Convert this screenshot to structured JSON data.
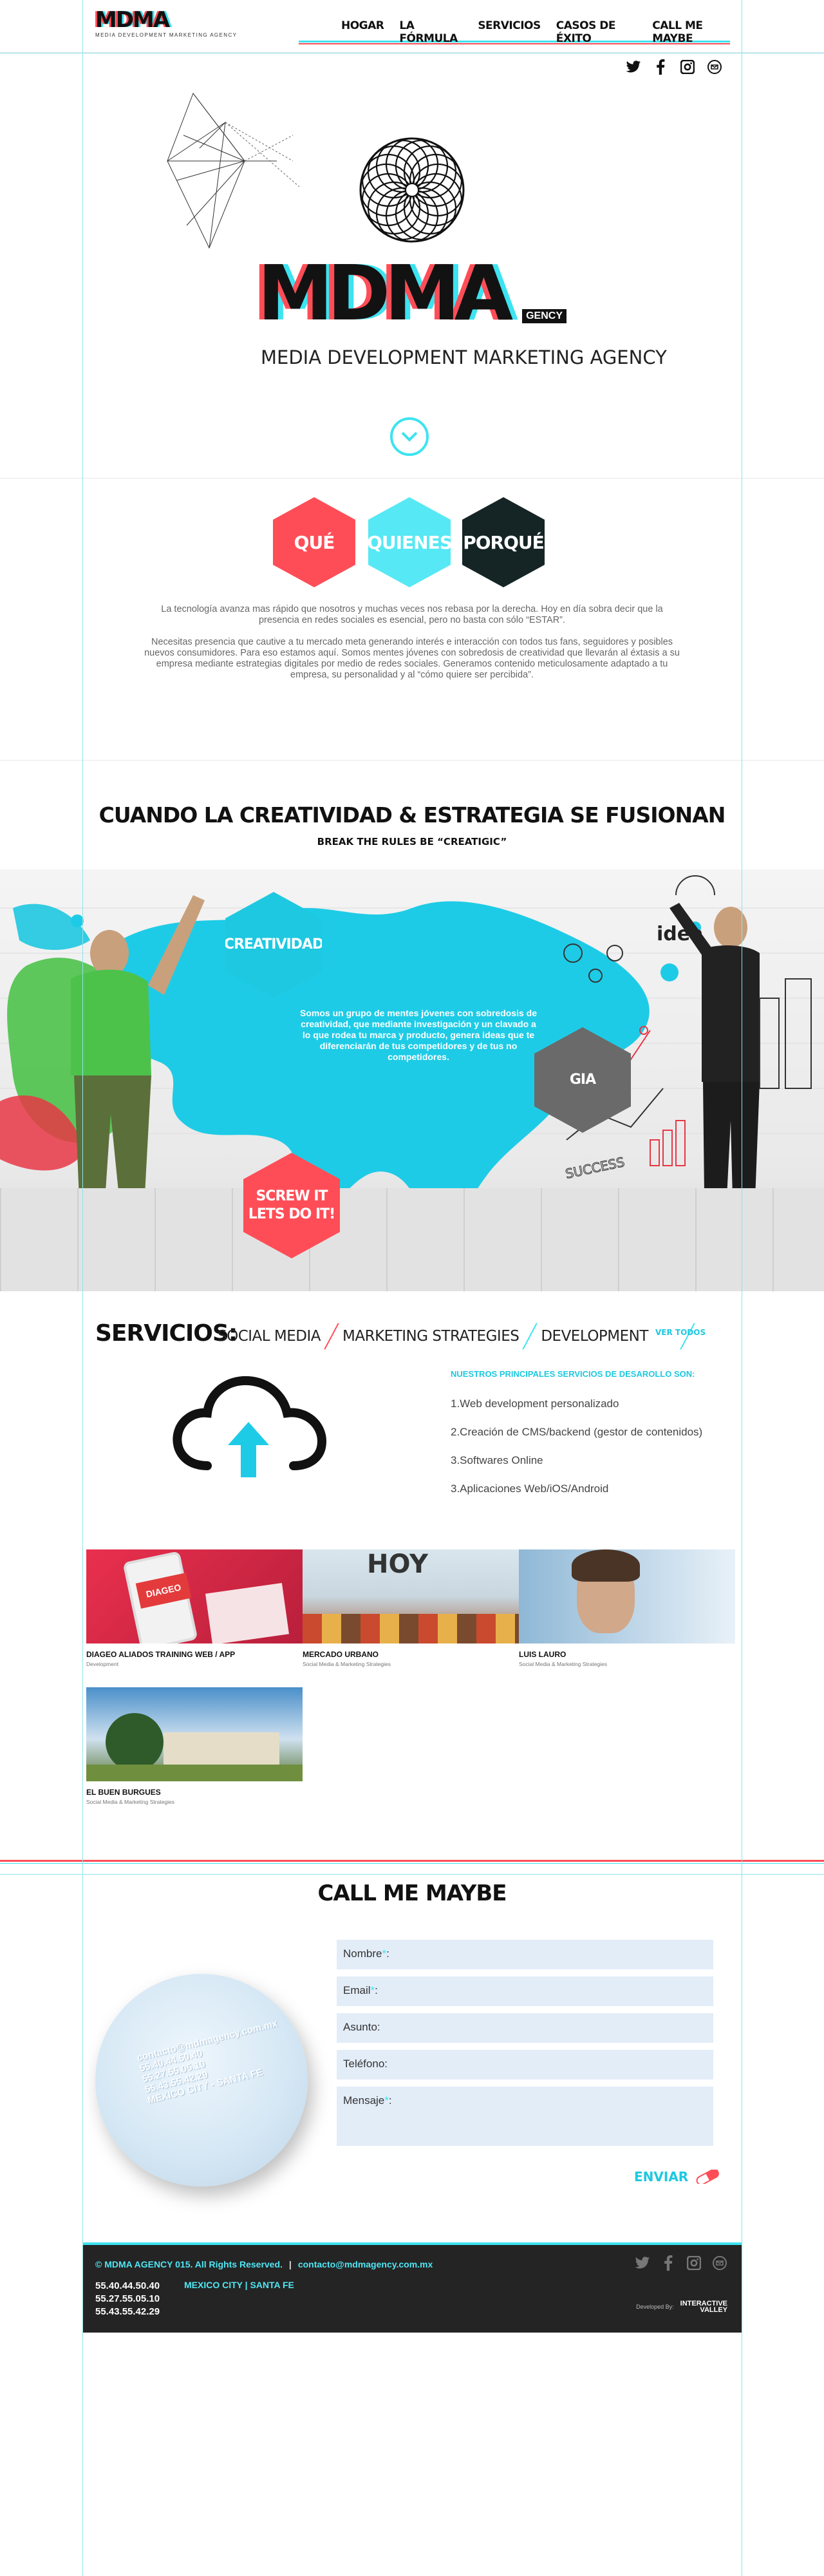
{
  "header": {
    "logo_word": "MDMA",
    "logo_sub": "MEDIA  DEVELOPMENT  MARKETING  AGENCY",
    "nav": [
      "HOGAR",
      "LA FÓRMULA",
      "SERVICIOS",
      "CASOS DE ÉXITO",
      "CALL ME MAYBE"
    ]
  },
  "social": [
    "twitter-icon",
    "facebook-icon",
    "instagram-icon",
    "email-icon"
  ],
  "hero": {
    "title": "MDMA",
    "gency": "GENCY",
    "tagline": "MEDIA  DEVELOPMENT  MARKETING  AGENCY"
  },
  "about": {
    "hexes": [
      {
        "label": "QUÉ",
        "color": "#ff4d57"
      },
      {
        "label": "QUIENES",
        "color": "#56e8f4"
      },
      {
        "label": "PORQUÉ",
        "color": "#152424"
      }
    ],
    "p1": "La tecnología avanza mas rápido que nosotros y muchas veces nos rebasa por la derecha. Hoy en día sobra decir que la presencia en redes sociales es esencial, pero no basta con sólo “ESTAR”.",
    "p2": "Necesitas presencia que cautive a tu mercado meta generando  interés e interacción con todos tus fans, seguidores y posibles nuevos consumidores. Para eso estamos aquí. Somos mentes jóvenes con sobredosis de creatividad que llevarán al éxtasis a su empresa mediante estrategias digitales por medio de redes sociales. Generamos contenido meticulosamente adaptado a tu empresa, su personalidad y al “cómo quiere ser percibida”."
  },
  "headline": {
    "title": "CUANDO LA CREATIVIDAD & ESTRATEGIA SE FUSIONAN",
    "sub": "BREAK THE RULES BE “CREATIGIC”"
  },
  "banner": {
    "hex_creatividad": "CREATIVIDAD",
    "hex_estrategia": "GIA",
    "hex_screw": "SCREW IT\nLETS DO IT!",
    "copy": "Somos  un grupo de mentes jóvenes con sobredosis de creatividad, que mediante investigación y un clavado a lo que rodea tu marca y producto, genera ideas que te diferenciarán de tus competidores y de tus no competidores.",
    "idea": "idea",
    "success": "SUCCESS"
  },
  "services": {
    "title": "SERVICIOS:",
    "tabs": [
      "SOCIAL MEDIA",
      "MARKETING STRATEGIES",
      "DEVELOPMENT"
    ],
    "ver_todos": "VER TODOS",
    "list_title": "NUESTROS PRINCIPALES SERVICIOS DE DESAROLLO SON:",
    "list": [
      "1.Web development personalizado",
      "2.Creación de CMS/backend  (gestor de contenidos)",
      "3.Softwares Online",
      "3.Aplicaciones Web/iOS/Android"
    ]
  },
  "portfolio": [
    {
      "title": "DIAGEO ALIADOS TRAINING WEB / APP",
      "sub": "Development",
      "img_text": "DIAGEO"
    },
    {
      "title": "MERCADO URBANO",
      "sub": "Social Media & Marketing Strategies",
      "img_text": "HOY"
    },
    {
      "title": "LUIS LAURO",
      "sub": "Social Media & Marketing Strategies"
    },
    {
      "title": "EL BUEN BURGUES",
      "sub": "Social Media & Marketing Strategies"
    }
  ],
  "contact": {
    "title": "CALL ME MAYBE",
    "disc_text": "contacto@mdmagency.com.mx\n55.40.44.50.40\n55.27.55.05.10\n55.43.55.42.29\nMEXICO CITY  -  SANTA FE",
    "fields": [
      {
        "label": "Nombre",
        "req": "*",
        "suffix": ":"
      },
      {
        "label": "Email",
        "req": "*",
        "suffix": ":"
      },
      {
        "label": "Asunto:",
        "req": "",
        "suffix": ""
      },
      {
        "label": "Teléfono:",
        "req": "",
        "suffix": ""
      },
      {
        "label": "Mensaje",
        "req": "*",
        "suffix": ":"
      }
    ],
    "send": "ENVIAR"
  },
  "footer": {
    "copyright": "© MDMA AGENCY 015. All Rights Reserved.",
    "sep": "|",
    "email": "contacto@mdmagency.com.mx",
    "phones": [
      "55.40.44.50.40",
      "55.27.55.05.10",
      "55.43.55.42.29"
    ],
    "city": "MEXICO CITY  |  SANTA FE",
    "developed_by": "Developed By:",
    "developer": "INTERACTIVE\nVALLEY"
  }
}
